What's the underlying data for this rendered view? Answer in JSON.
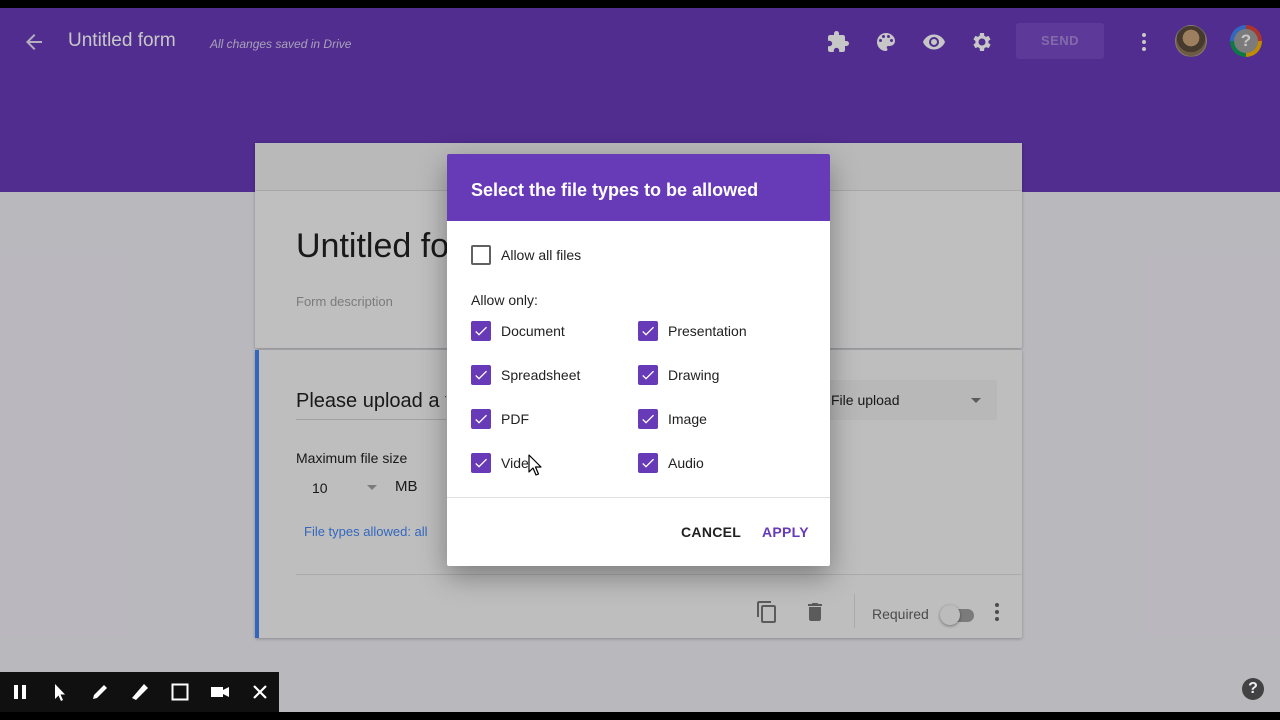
{
  "topbar": {
    "title": "Untitled form",
    "saved_status": "All changes saved in Drive",
    "send_label": "SEND",
    "icons": [
      "addon-icon",
      "palette-icon",
      "preview-eye-icon",
      "settings-gear-icon",
      "more-vert-icon"
    ],
    "help_label": "?"
  },
  "form": {
    "title": "Untitled form",
    "description_placeholder": "Form description"
  },
  "question": {
    "title": "Please upload a file",
    "type_label": "File upload",
    "max_size_label": "Maximum file size",
    "max_size_value": "10",
    "max_size_unit": "MB",
    "file_types_link": "File types allowed: all",
    "required_label": "Required",
    "required_on": false
  },
  "dialog": {
    "title": "Select the file types to be allowed",
    "allow_all_label": "Allow all files",
    "allow_all_checked": false,
    "allow_only_label": "Allow only:",
    "options": [
      {
        "label": "Document",
        "checked": true
      },
      {
        "label": "Presentation",
        "checked": true
      },
      {
        "label": "Spreadsheet",
        "checked": true
      },
      {
        "label": "Drawing",
        "checked": true
      },
      {
        "label": "PDF",
        "checked": true
      },
      {
        "label": "Image",
        "checked": true
      },
      {
        "label": "Video",
        "checked": true
      },
      {
        "label": "Audio",
        "checked": true
      }
    ],
    "cancel_label": "CANCEL",
    "apply_label": "APPLY"
  },
  "recorder_toolbar": {
    "icons": [
      "pause-icon",
      "pointer-icon",
      "pen-icon",
      "highlighter-icon",
      "rectangle-icon",
      "camera-icon",
      "close-icon"
    ]
  },
  "help_corner_label": "?",
  "colors": {
    "brand_purple": "#673ab7",
    "link_blue": "#4285f4"
  }
}
